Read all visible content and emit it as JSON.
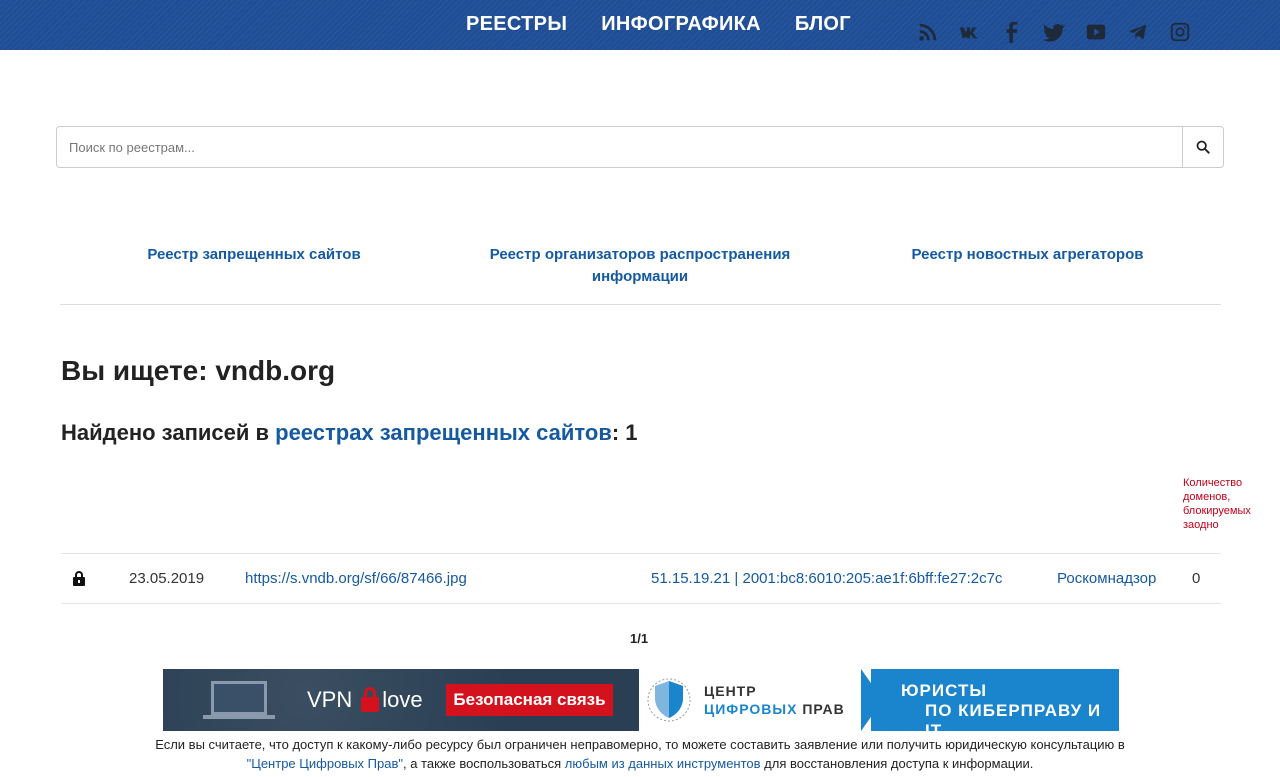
{
  "nav": {
    "items": [
      "РЕЕСТРЫ",
      "ИНФОГРАФИКА",
      "БЛОГ"
    ]
  },
  "social": [
    "rss-icon",
    "vk-icon",
    "facebook-icon",
    "twitter-icon",
    "youtube-icon",
    "telegram-icon",
    "instagram-icon"
  ],
  "search": {
    "placeholder": "Поиск по реестрам...",
    "value": ""
  },
  "registries": [
    "Реестр запрещенных сайтов",
    "Реестр организаторов распространения информации",
    "Реестр новостных агрегаторов"
  ],
  "result": {
    "heading_prefix": "Вы ищете: ",
    "query": "vndb.org",
    "found_prefix": "Найдено записей в ",
    "found_link": "реестрах запрещенных сайтов",
    "found_suffix": ": 1"
  },
  "table": {
    "domains_header": "Количество доменов, блокируемых заодно",
    "rows": [
      {
        "date": "23.05.2019",
        "url": "https://s.vndb.org/sf/66/87466.jpg",
        "ip": "51.15.19.21 | 2001:bc8:6010:205:ae1f:6bff:fe27:2c7c",
        "authority": "Роскомнадзор",
        "count": "0"
      }
    ]
  },
  "pager": "1/1",
  "banner_left": {
    "vpn": "VPN",
    "love": "love",
    "button": "Безопасная связь"
  },
  "banner_right": {
    "line1": "ЦЕНТР",
    "line2_blue": "ЦИФРОВЫХ",
    "line2_rest": " ПРАВ",
    "law1": "ЮРИСТЫ",
    "law2": "ПО КИБЕРПРАВУ И IT"
  },
  "footer": {
    "text1": "Если вы считаете, что доступ к какому-либо ресурсу был ограничен неправомерно, то можете составить заявление или получить юридическую консультацию в",
    "link1": "\"Центре Цифровых Прав\"",
    "text2": ", а также воспользоваться ",
    "link2": "любым из данных инструментов",
    "text3": " для восстановления доступа к информации."
  },
  "colors": {
    "topbar": "#1f4e96",
    "link": "#155aa0",
    "note": "#c0001a",
    "banner_red": "#d3121e",
    "banner_blue": "#1a84cc"
  }
}
